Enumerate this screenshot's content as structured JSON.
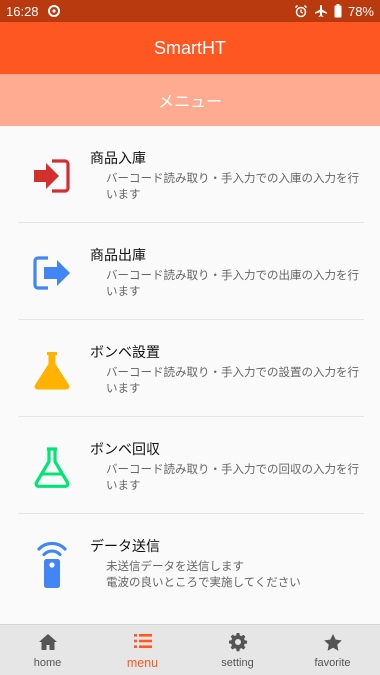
{
  "status": {
    "time": "16:28",
    "battery": "78%"
  },
  "app": {
    "title": "SmartHT"
  },
  "subheader": {
    "title": "メニュー"
  },
  "menu": [
    {
      "title": "商品入庫",
      "desc": "バーコード読み取り・手入力での入庫の入力を行います",
      "icon": "stock-in-icon",
      "color": "#d32f2f"
    },
    {
      "title": "商品出庫",
      "desc": "バーコード読み取り・手入力での出庫の入力を行います",
      "icon": "stock-out-icon",
      "color": "#4285f4"
    },
    {
      "title": "ボンベ設置",
      "desc": "バーコード読み取り・手入力での設置の入力を行います",
      "icon": "flask-filled-icon",
      "color": "#ffb300"
    },
    {
      "title": "ボンベ回収",
      "desc": "バーコード読み取り・手入力での回収の入力を行います",
      "icon": "flask-outline-icon",
      "color": "#00e676"
    },
    {
      "title": "データ送信",
      "desc": "未送信データを送信します\n電波の良いところで実施してください",
      "icon": "remote-signal-icon",
      "color": "#4285f4"
    }
  ],
  "nav": [
    {
      "label": "home",
      "icon": "home-icon"
    },
    {
      "label": "menu",
      "icon": "menu-list-icon",
      "active": true
    },
    {
      "label": "setting",
      "icon": "gear-icon"
    },
    {
      "label": "favorite",
      "icon": "star-icon"
    }
  ]
}
